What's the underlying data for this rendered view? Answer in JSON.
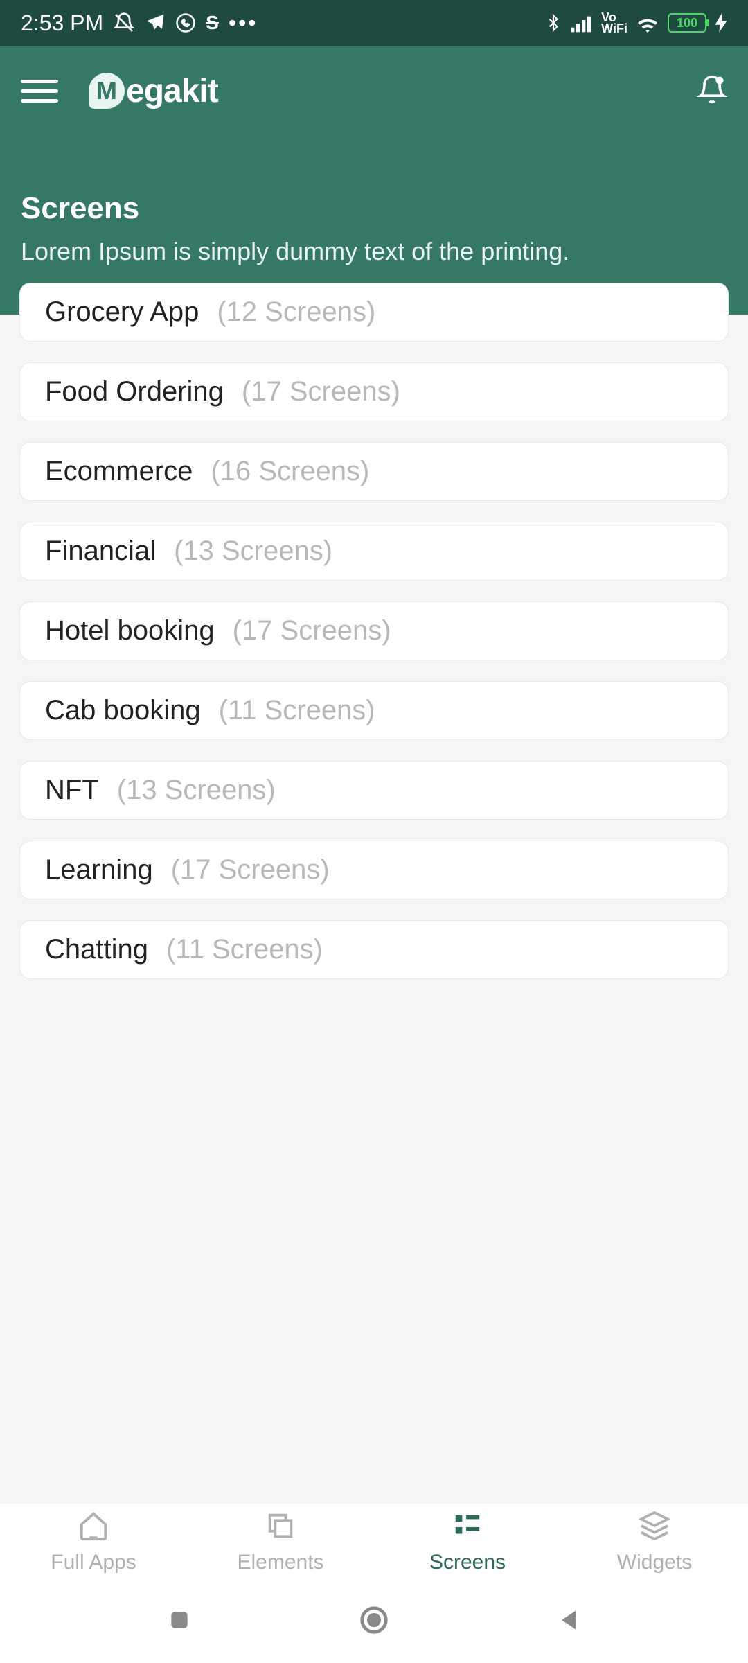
{
  "status": {
    "time": "2:53 PM",
    "battery": "100",
    "vowifi_top": "Vo",
    "vowifi_bottom": "WiFi"
  },
  "header": {
    "logo_text": "egakit",
    "logo_mark": "M"
  },
  "page": {
    "title": "Screens",
    "subtitle": "Lorem Ipsum is simply dummy text of the printing."
  },
  "cards": [
    {
      "title": "Grocery App",
      "meta": "(12 Screens)"
    },
    {
      "title": "Food Ordering",
      "meta": "(17 Screens)"
    },
    {
      "title": "Ecommerce",
      "meta": "(16 Screens)"
    },
    {
      "title": "Financial",
      "meta": "(13 Screens)"
    },
    {
      "title": "Hotel booking",
      "meta": "(17 Screens)"
    },
    {
      "title": "Cab booking",
      "meta": "(11 Screens)"
    },
    {
      "title": "NFT",
      "meta": "(13 Screens)"
    },
    {
      "title": "Learning",
      "meta": "(17 Screens)"
    },
    {
      "title": "Chatting",
      "meta": "(11 Screens)"
    }
  ],
  "nav": {
    "items": [
      {
        "label": "Full Apps"
      },
      {
        "label": "Elements"
      },
      {
        "label": "Screens"
      },
      {
        "label": "Widgets"
      }
    ]
  }
}
